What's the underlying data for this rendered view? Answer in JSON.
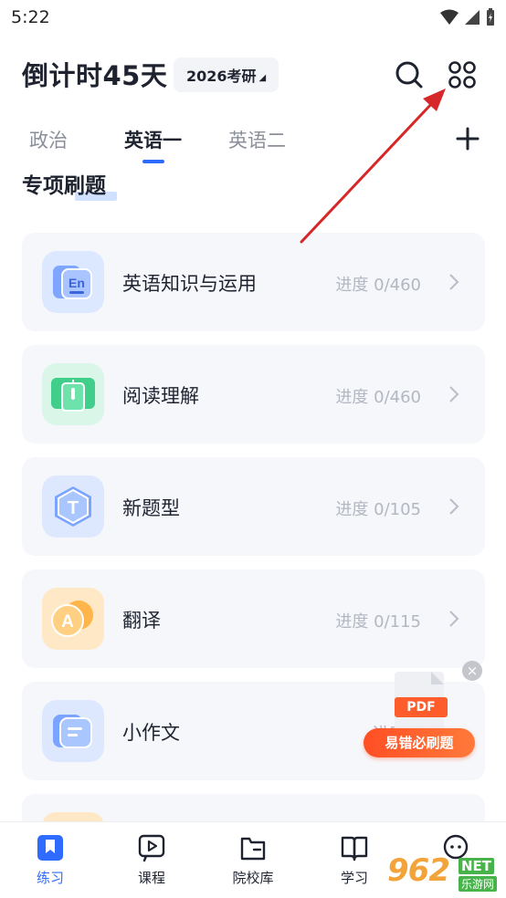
{
  "status_bar": {
    "time": "5:22"
  },
  "header": {
    "countdown": "倒计时45天",
    "exam_year": "2026考研",
    "search_icon": "search-icon",
    "apps_icon": "apps-grid-icon"
  },
  "tabs": [
    {
      "label": "政治",
      "active": false
    },
    {
      "label": "英语一",
      "active": true
    },
    {
      "label": "英语二",
      "active": false
    }
  ],
  "section": {
    "title": "专项刷题"
  },
  "cards": [
    {
      "title": "英语知识与运用",
      "progress": "进度 0/460",
      "icon": "english-knowledge-icon",
      "color": "#6f9cff"
    },
    {
      "title": "阅读理解",
      "progress": "进度 0/460",
      "icon": "book-reading-icon",
      "color": "#3ecf8a"
    },
    {
      "title": "新题型",
      "progress": "进度 0/105",
      "icon": "new-question-type-icon",
      "color": "#5b8dff"
    },
    {
      "title": "翻译",
      "progress": "进度 0/115",
      "icon": "translation-icon",
      "color": "#ffb043"
    },
    {
      "title": "小作文",
      "progress": "进度 0",
      "icon": "short-essay-icon",
      "color": "#5b8dff"
    }
  ],
  "float_ad": {
    "file_label": "PDF",
    "badge": "易错必刷题"
  },
  "bottom_nav": [
    {
      "label": "练习",
      "icon": "bookmark-icon",
      "active": true
    },
    {
      "label": "课程",
      "icon": "course-play-icon",
      "active": false
    },
    {
      "label": "院校库",
      "icon": "school-folder-icon",
      "active": false
    },
    {
      "label": "学习",
      "icon": "open-book-icon",
      "active": false
    },
    {
      "label": "",
      "icon": "chat-icon",
      "active": false
    }
  ],
  "watermark": {
    "number": "962",
    "net": "NET",
    "sub": "乐游网"
  },
  "colors": {
    "accent": "#2f6bff",
    "card_bg": "#f6f7fb",
    "annotation_arrow": "#d62828"
  }
}
